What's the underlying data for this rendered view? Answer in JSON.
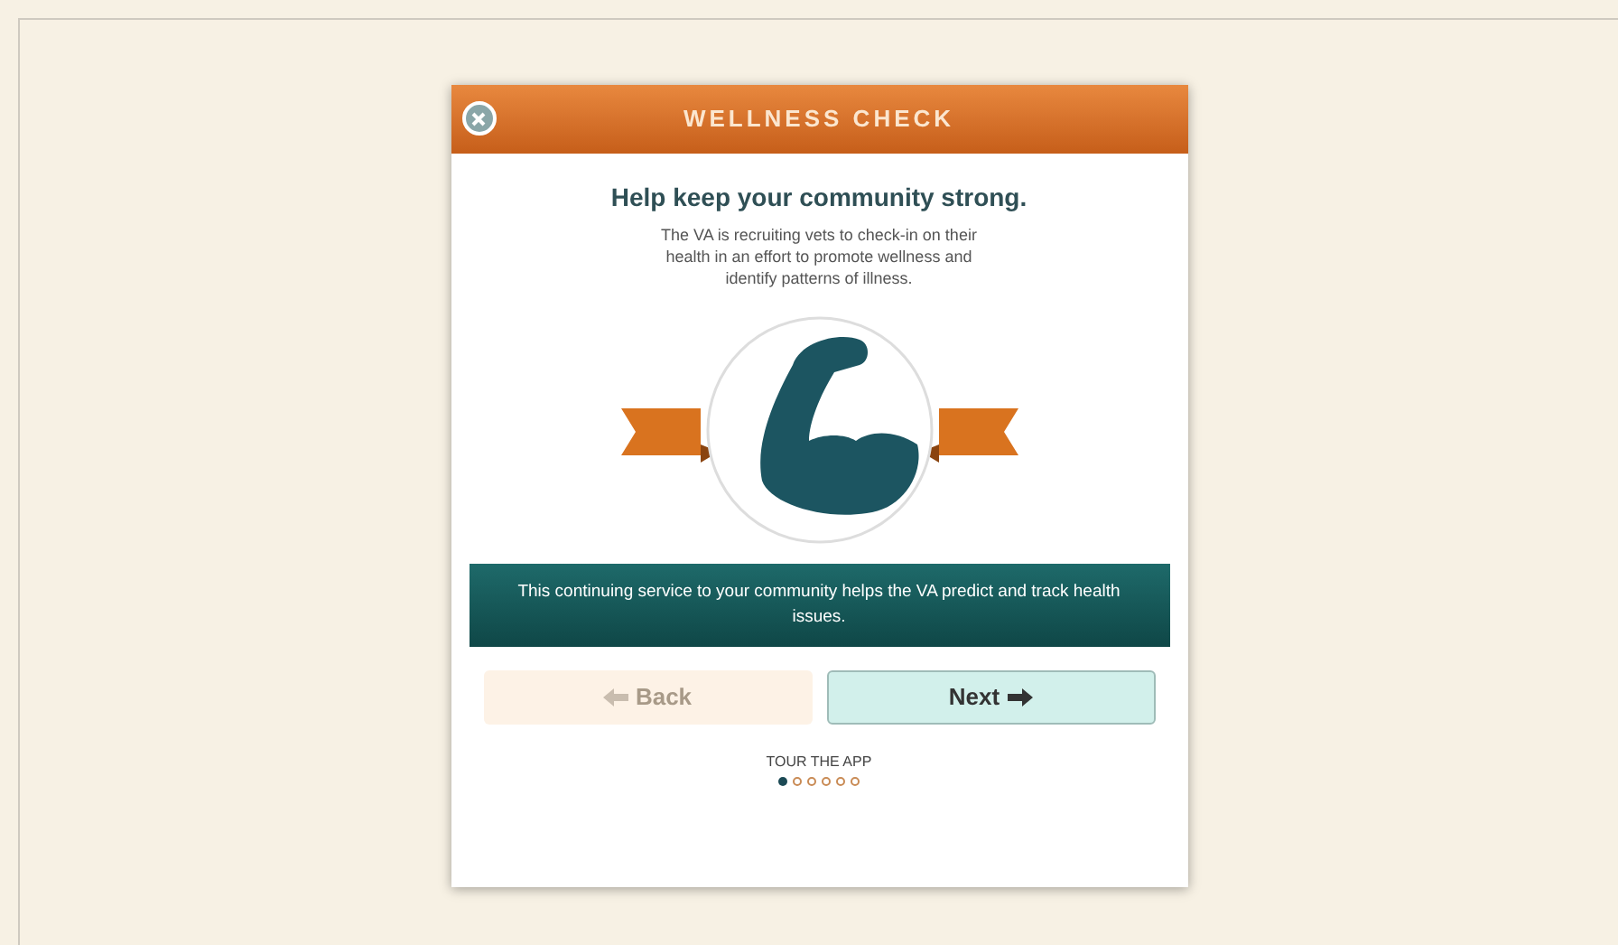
{
  "dialog": {
    "title": "WELLNESS CHECK",
    "heading": "Help keep your community strong.",
    "description": "The VA is recruiting vets to check-in on their health in an effort to promote wellness and identify patterns of illness.",
    "banner": "This continuing service to your community helps the VA predict and track health issues.",
    "buttons": [
      {
        "label": "Back",
        "kind": "back",
        "disabled": true
      },
      {
        "label": "Next",
        "kind": "next",
        "disabled": false
      }
    ],
    "tour_label": "TOUR THE APP",
    "steps": [
      {
        "selected": true
      },
      {
        "selected": false
      },
      {
        "selected": false
      },
      {
        "selected": false
      },
      {
        "selected": false
      },
      {
        "selected": false
      }
    ]
  }
}
